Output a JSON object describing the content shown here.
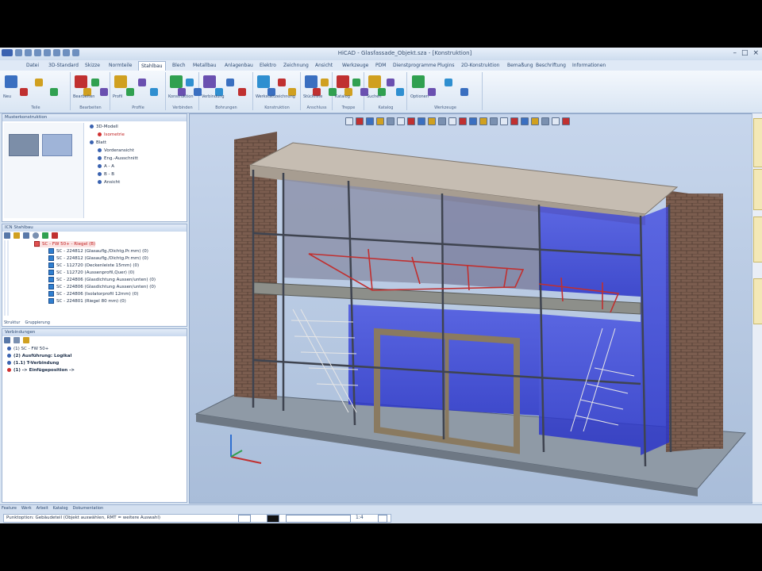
{
  "window": {
    "title": "HiCAD - Glasfassade_Objekt.sza - [Konstruktion]"
  },
  "tabs": [
    "Datei",
    "3D-Standard",
    "Skizze",
    "Normteile",
    "Stahlbau",
    "Blech",
    "Metallbau",
    "Anlagenbau",
    "Elektro",
    "Zeichnung",
    "Ansicht",
    "Werkzeuge",
    "PDM",
    "Dienstprogramme",
    "Plugins",
    "2D-Konstruktion",
    "Bemaßung",
    "Beschriftung",
    "Informationen"
  ],
  "active_tab_index": 4,
  "ribbon": {
    "groups": [
      "Teile",
      "Bearbeiten",
      "Profile",
      "Verbinden",
      "Bohrungen",
      "Konstruktion",
      "Anschluss",
      "Treppe",
      "Katalog",
      "Werkzeuge"
    ],
    "labels": [
      "Neu",
      "Bearbeiten",
      "Profil",
      "Konstruktion",
      "Verbindung",
      "Werkstattzeichnung",
      "Stückliste",
      "Katalog",
      "Suchen",
      "Optionen"
    ]
  },
  "top_left_panel": {
    "title": "Musterkonstruktion",
    "tree": [
      {
        "label": "3D-Modell",
        "color": "blue",
        "indent": 0
      },
      {
        "label": "Isometrie",
        "color": "red",
        "indent": 1
      },
      {
        "label": "Blatt",
        "color": "blue",
        "indent": 0
      },
      {
        "label": "Vorderansicht",
        "color": "blue",
        "indent": 1
      },
      {
        "label": "Eng.-Ausschnitt",
        "color": "blue",
        "indent": 1
      },
      {
        "label": "A - A",
        "color": "blue",
        "indent": 1
      },
      {
        "label": "B - B",
        "color": "blue",
        "indent": 1
      },
      {
        "label": "Ansicht",
        "color": "blue",
        "indent": 1
      }
    ]
  },
  "mid_left_panel": {
    "title": "ICN Stahlbau",
    "header_row": "SC - FW 50+ - Riegel (B)",
    "rows": [
      "SC - 224812 (Glasauflg./Dichtg.Pr.mm) (0)",
      "SC - 224812 (Glasauflg./Dichtg.Pr.mm) (0)",
      "SC - 112720 (Deckenleiste 15mm) (0)",
      "SC - 112720 (Aussenprofil,Quer) (0)",
      "SC - 224806 (Glasdichtung Aussen/unten) (0)",
      "SC - 224806 (Glasdichtung Aussen/unten) (0)",
      "SC - 224806 (Isolatorprofil 12mm) (0)",
      "SC - 224801 (Riegel 80 mm) (0)"
    ],
    "footer_tabs": [
      "Struktur",
      "Gruppierung"
    ]
  },
  "lower_left_panel": {
    "title": "Verbindungen",
    "items": [
      {
        "label": "(1) SC - FW 50+",
        "bold": false
      },
      {
        "label": "(2) Ausführung: Logikal",
        "bold": true
      },
      {
        "label": "(1.1) T-Verbindung",
        "bold": true
      },
      {
        "label": "(1) -> Einfügeposition ->",
        "bold": true
      }
    ]
  },
  "status": {
    "tabs": [
      "Feature",
      "Werk",
      "Arbeit",
      "Katalog",
      "Dokumentation"
    ],
    "command": "Punktoption: Gebäudeteil (Objekt auswählen, RMT = weitere Auswahl)",
    "zoom": "1:4"
  },
  "viewport": {
    "toolbar_icon_count": 22
  }
}
